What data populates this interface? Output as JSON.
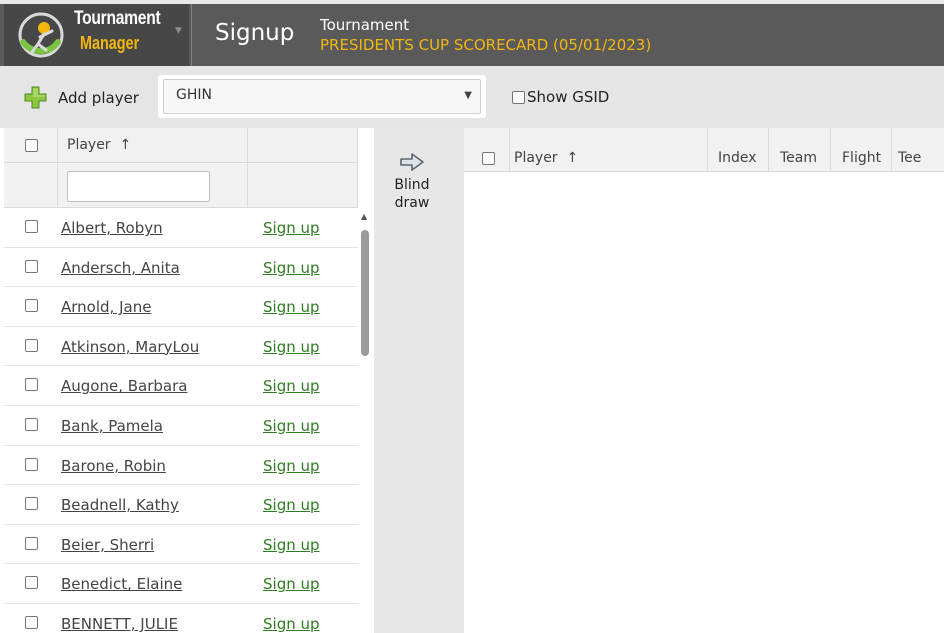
{
  "header": {
    "logo_line1": "Tournament",
    "logo_line2": "Manager",
    "page_title": "Signup",
    "tournament_label": "Tournament",
    "tournament_name": "PRESIDENTS CUP SCORECARD (05/01/2023)"
  },
  "toolbar": {
    "add_player_label": "Add player",
    "id_type_selected": "GHIN",
    "show_gsid_label": "Show GSID"
  },
  "available": {
    "column_player": "Player",
    "sort_arrow": "↑",
    "signup_label": "Sign up",
    "players": [
      "Albert, Robyn",
      "Andersch, Anita",
      "Arnold, Jane",
      "Atkinson, MaryLou",
      "Augone, Barbara",
      "Bank, Pamela",
      "Barone, Robin",
      "Beadnell, Kathy",
      "Beier, Sherri",
      "Benedict, Elaine",
      "BENNETT, JULIE"
    ]
  },
  "middle": {
    "blind_draw_label": "Blind draw"
  },
  "signed_up": {
    "columns": [
      "Player",
      "Index",
      "Team",
      "Flight",
      "Tee"
    ],
    "sort_arrow": "↑",
    "rows": []
  },
  "colors": {
    "header_bg": "#5a5a5a",
    "accent_gold": "#f2b70f",
    "signup_link": "#2e7d22",
    "logo_green": "#7cc243"
  },
  "icons": {
    "add_player": "plus-icon",
    "blind_draw": "arrow-right-icon",
    "select": "chevron-down-icon"
  }
}
